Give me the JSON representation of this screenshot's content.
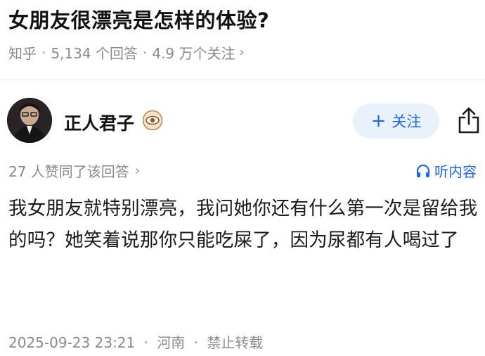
{
  "question": {
    "title": "女朋友很漂亮是怎样的体验?",
    "source": "知乎",
    "answers_count": "5,134 个回答",
    "followers": "4.9 万个关注",
    "separator": "·",
    "chevron": "›"
  },
  "author": {
    "name": "正人君子",
    "badge_icon": "eye-badge-icon",
    "follow_label": "关注",
    "follow_plus": "+",
    "share_icon": "share-icon"
  },
  "answer": {
    "agree_text": "27 人赞同了该回答",
    "listen_label": "听内容",
    "content": "我女朋友就特别漂亮，我问她你还有什么第一次是留给我的吗？她笑着说那你只能吃屎了，因为尿都有人喝过了"
  },
  "footer": {
    "date": "2025-09-23 23:21",
    "location": "河南",
    "copyright": "禁止转载"
  },
  "colors": {
    "accent": "#1a66ff",
    "follow_bg": "#e9f1fd",
    "meta_gray": "#8a8a8a"
  }
}
